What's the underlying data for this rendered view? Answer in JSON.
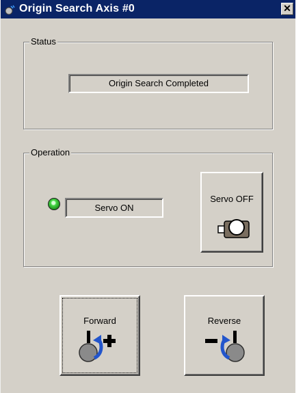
{
  "window": {
    "title": "Origin Search Axis #0",
    "close_label": "✕"
  },
  "status": {
    "group_label": "Status",
    "text": "Origin Search Completed"
  },
  "operation": {
    "group_label": "Operation",
    "servo_state": "Servo ON",
    "servo_off_label": "Servo OFF"
  },
  "jog": {
    "forward_label": "Forward",
    "reverse_label": "Reverse"
  },
  "icons": {
    "window": "app-icon",
    "indicator": "green-led-icon",
    "servo": "motor-icon",
    "forward": "rotate-forward-icon",
    "reverse": "rotate-reverse-icon"
  },
  "colors": {
    "titlebar": "#0a2466",
    "led": "#48d848",
    "rotation_arrow": "#2255cc"
  }
}
